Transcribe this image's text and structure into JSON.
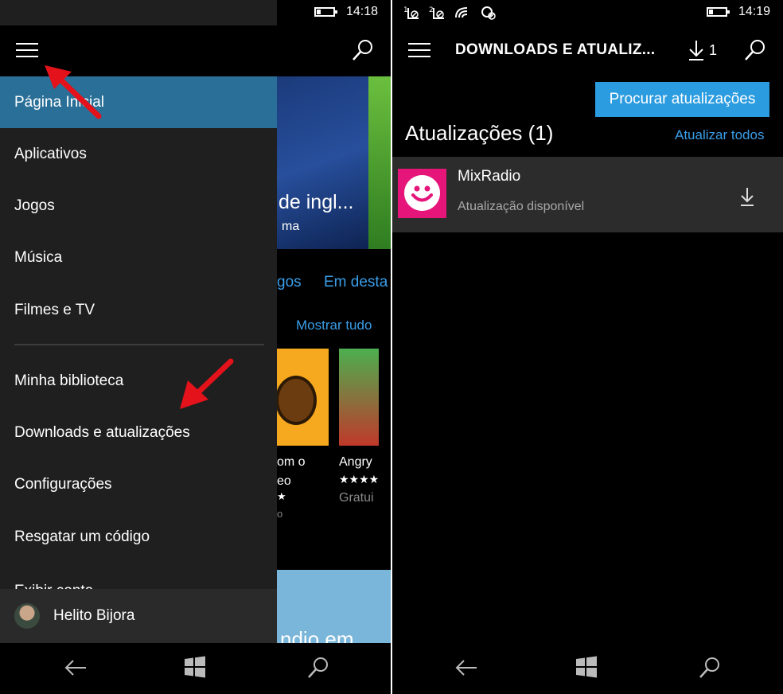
{
  "left": {
    "status": {
      "time": "14:18",
      "battery_level": 0.25,
      "signal_icons": [
        "sim1-no-signal-icon",
        "sim2-no-signal-icon",
        "wifi-icon",
        "location-icon",
        "record-icon"
      ]
    },
    "background": {
      "banner_title": "de ingl...",
      "banner_sub": "ma",
      "tabs": [
        "gos",
        "Em desta"
      ],
      "show_all": "Mostrar tudo",
      "apps": [
        {
          "line1": "om o",
          "line2": "eo",
          "line3": "★",
          "line4": "o"
        },
        {
          "line1": "Angry",
          "line2": "★★★★",
          "line3": "Gratui"
        }
      ],
      "bottom_tile_text": "ndio em"
    },
    "drawer": {
      "items": [
        {
          "label": "Página Inicial",
          "active": true
        },
        {
          "label": "Aplicativos"
        },
        {
          "label": "Jogos"
        },
        {
          "label": "Música"
        },
        {
          "label": "Filmes e TV"
        },
        {
          "label": "Minha biblioteca"
        },
        {
          "label": "Downloads e atualizações"
        },
        {
          "label": "Configurações"
        },
        {
          "label": "Resgatar um código"
        }
      ],
      "cut_item": "Exibir conta",
      "user_name": "Helito Bijora"
    },
    "colors": {
      "accent": "#2a6f97",
      "annotation": "#e3121b"
    }
  },
  "right": {
    "status": {
      "time": "14:19",
      "battery_level": 0.25
    },
    "header": {
      "title": "DOWNLOADS E ATUALIZ...",
      "download_count": "1"
    },
    "find_updates_button": "Procurar atualizações",
    "section_title": "Atualizações (1)",
    "update_all": "Atualizar todos",
    "app": {
      "name": "MixRadio",
      "status": "Atualização disponível",
      "icon_color": "#e5157a"
    },
    "colors": {
      "button": "#2c9ce0",
      "link": "#3a9ee8"
    }
  }
}
